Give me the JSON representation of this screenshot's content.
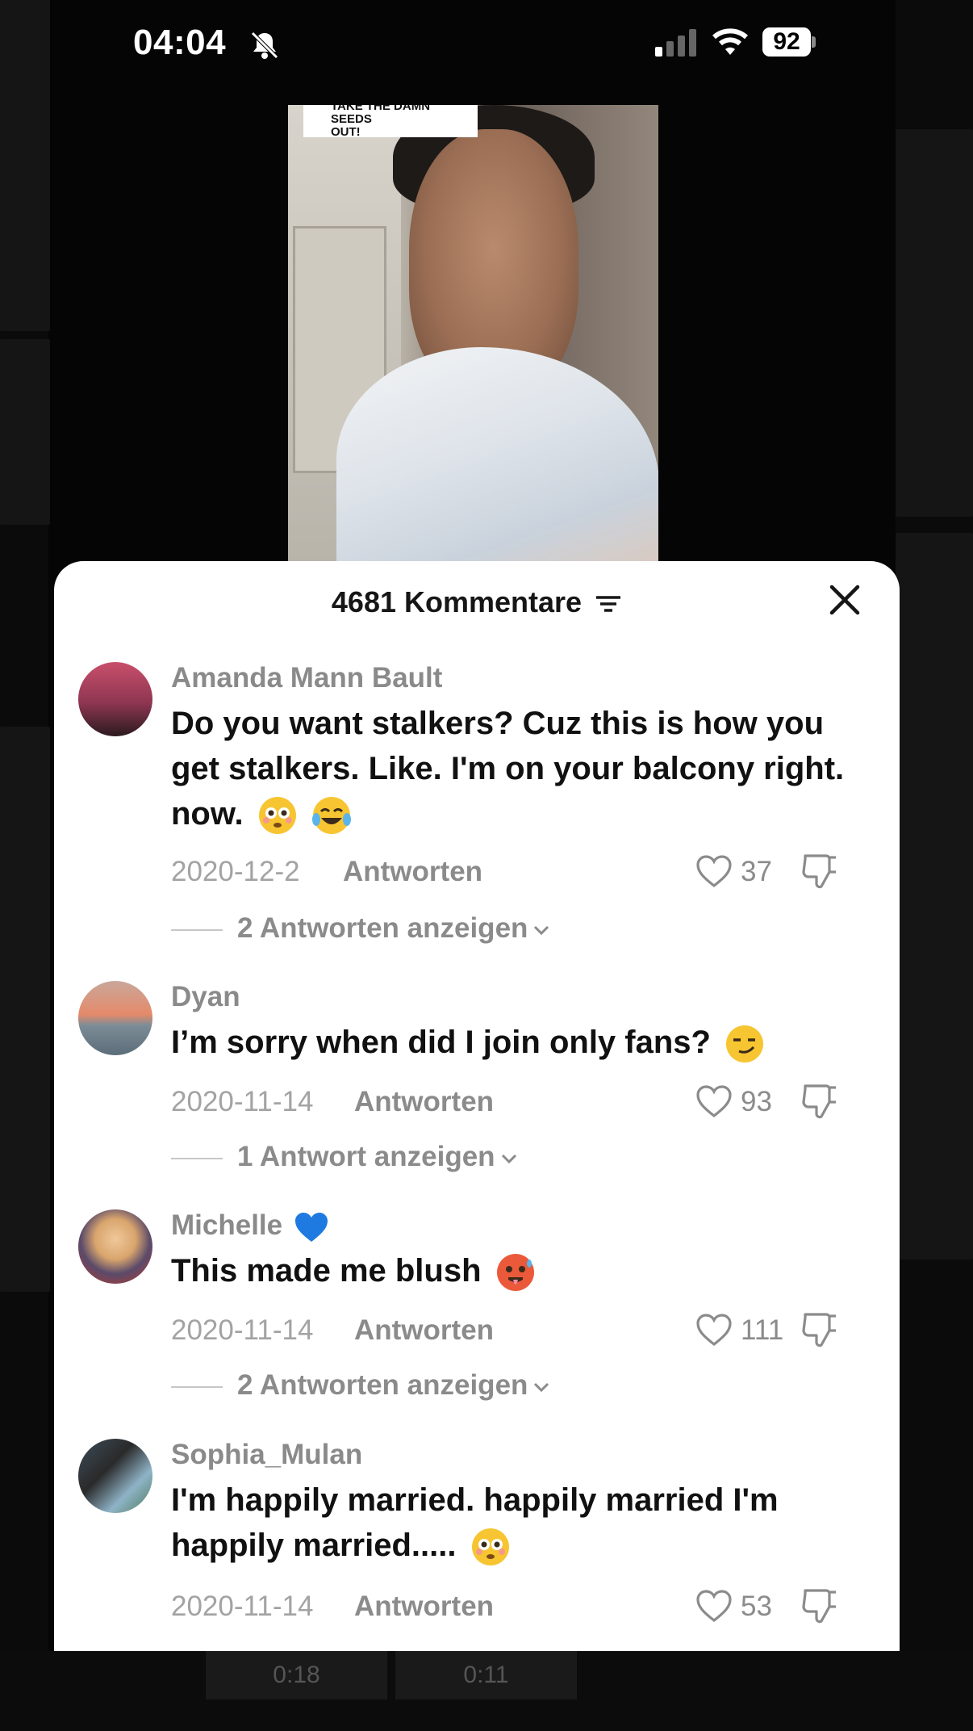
{
  "status_bar": {
    "time": "04:04",
    "battery": "92",
    "icons": [
      "bell-slash-icon",
      "signal-icon",
      "wifi-icon",
      "battery-icon"
    ]
  },
  "video": {
    "caption_line1": "TAKE THE DAMN SEEDS",
    "caption_line2": "OUT!"
  },
  "comments_sheet": {
    "title": "4681 Kommentare",
    "sort_icon": "sort-icon",
    "close_icon": "close-icon",
    "comments": [
      {
        "username": "Amanda Mann Bault",
        "text": "Do you want stalkers? Cuz this is how you get stalkers. Like. I'm on your balcony right. now.",
        "emojis": [
          "flushed-emoji",
          "laughing-tears-emoji"
        ],
        "date": "2020-12-2",
        "reply_label": "Antworten",
        "likes": "37",
        "show_replies": "2 Antworten anzeigen"
      },
      {
        "username": "Dyan",
        "text": "I’m sorry when did I join only fans?",
        "emojis": [
          "smirk-emoji"
        ],
        "date": "2020-11-14",
        "reply_label": "Antworten",
        "likes": "93",
        "show_replies": "1 Antwort anzeigen"
      },
      {
        "username": "Michelle",
        "badge": "blue-heart-emoji",
        "text": "This made me blush",
        "emojis": [
          "hot-face-emoji"
        ],
        "date": "2020-11-14",
        "reply_label": "Antworten",
        "likes": "111",
        "show_replies": "2 Antworten anzeigen"
      },
      {
        "username": "Sophia_Mulan",
        "text": "I'm happily married. happily married I'm happily married.....",
        "emojis": [
          "flushed-emoji"
        ],
        "date": "2020-11-14",
        "reply_label": "Antworten",
        "likes": "53"
      }
    ]
  },
  "background_thumbs": [
    "0:18",
    "0:11"
  ],
  "colors": {
    "sheet_bg": "#ffffff",
    "username": "#8a8a8a",
    "meta": "#a3a3a3",
    "text": "#111111"
  }
}
